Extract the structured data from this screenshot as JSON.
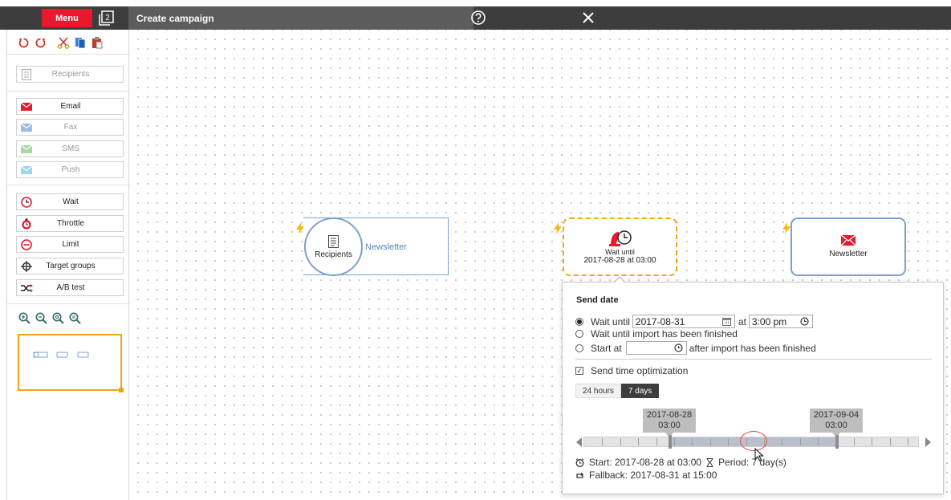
{
  "topbar": {
    "menu_label": "Menu",
    "window_count": "2",
    "title": "Create campaign"
  },
  "palette": {
    "recipients": "Recipients",
    "channels": [
      {
        "label": "Email",
        "enabled": true
      },
      {
        "label": "Fax",
        "enabled": false
      },
      {
        "label": "SMS",
        "enabled": false
      },
      {
        "label": "Push",
        "enabled": false
      }
    ],
    "logic": [
      {
        "label": "Wait"
      },
      {
        "label": "Throttle"
      },
      {
        "label": "Limit"
      },
      {
        "label": "Target groups"
      },
      {
        "label": "A/B test"
      }
    ]
  },
  "nodes": {
    "recipients": {
      "label": "Recipients",
      "name": "Newsletter"
    },
    "wait": {
      "line1": "Wait until",
      "line2": "2017-08-28 at 03:00"
    },
    "email": {
      "label": "Newsletter"
    }
  },
  "popup": {
    "title": "Send date",
    "option_wait_until": "Wait until",
    "date_value": "2017-08-31",
    "at_label": "at",
    "time_value": "3:00 pm",
    "option_import": "Wait until import has been finished",
    "option_start_at": "Start at",
    "start_at_value": "",
    "after_import": "after import has been finished",
    "sto_label": "Send time optimization",
    "tabs": [
      "24 hours",
      "7 days"
    ],
    "active_tab": "7 days",
    "marker_start_date": "2017-08-28",
    "marker_start_time": "03:00",
    "marker_end_date": "2017-09-04",
    "marker_end_time": "03:00",
    "start_text": "Start: 2017-08-28 at 03:00",
    "period_text": "Period: 7 day(s)",
    "fallback_text": "Fallback: 2017-08-31 at 15:00"
  },
  "colors": {
    "accent_red": "#e8192c",
    "highlight_orange": "#f2a516",
    "node_blue": "#7ba0d0",
    "topbar": "#3d3d3d"
  }
}
